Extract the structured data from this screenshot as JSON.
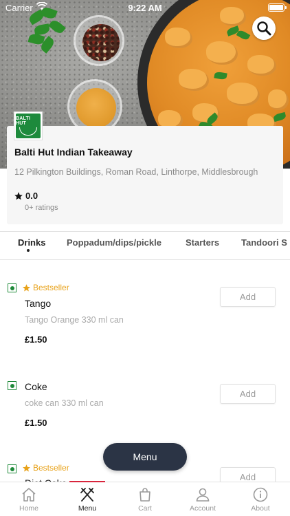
{
  "status_bar": {
    "carrier": "Carrier",
    "time": "9:22 AM"
  },
  "restaurant": {
    "logo_text": "BALTI HUT",
    "name": "Balti Hut Indian Takeaway",
    "address": "12 Pilkington Buildings, Roman Road, Linthorpe, Middlesbrough",
    "rating": "0.0",
    "ratings_count": "0+ ratings"
  },
  "tabs": [
    {
      "label": "Drinks",
      "active": true
    },
    {
      "label": "Poppadum/dips/pickle",
      "active": false
    },
    {
      "label": "Starters",
      "active": false
    },
    {
      "label": "Tandoori S",
      "active": false
    }
  ],
  "items": [
    {
      "badge": "Bestseller",
      "name": "Tango",
      "description": "Tango Orange 330 ml can",
      "price": "£1.50",
      "add_label": "Add"
    },
    {
      "badge": "",
      "name": "Coke",
      "description": "coke can 330 ml can",
      "price": "£1.50",
      "add_label": "Add"
    },
    {
      "badge": "Bestseller",
      "name": "Diet Coke",
      "description": "",
      "price": "",
      "add_label": "Add"
    }
  ],
  "menu_button": "Menu",
  "nav": [
    {
      "label": "Home",
      "icon": "home-icon",
      "active": false
    },
    {
      "label": "Menu",
      "icon": "fork-knife-icon",
      "active": true
    },
    {
      "label": "Cart",
      "icon": "bag-icon",
      "active": false
    },
    {
      "label": "Account",
      "icon": "user-icon",
      "active": false
    },
    {
      "label": "About",
      "icon": "info-icon",
      "active": false
    }
  ],
  "colors": {
    "accent": "#d8253c",
    "veg": "#1f8a3a",
    "bestseller": "#e8a21a",
    "fab": "#2b3445"
  }
}
